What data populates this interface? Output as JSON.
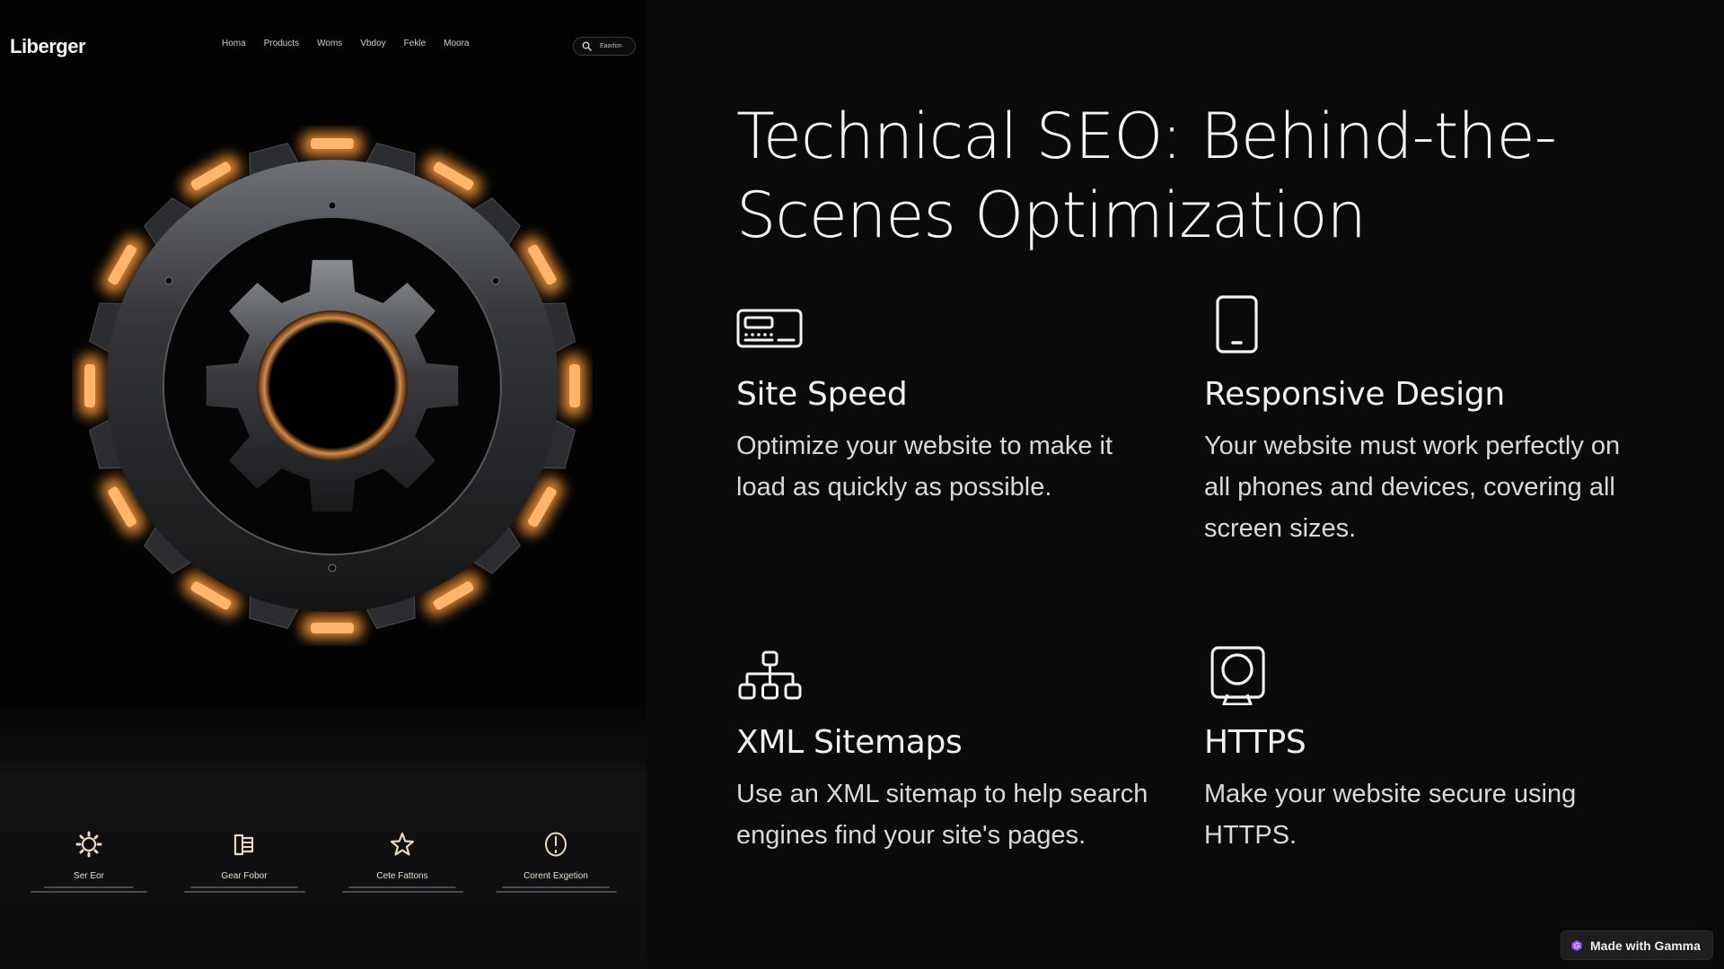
{
  "left_panel": {
    "logo": "Liberger",
    "nav": [
      "Homa",
      "Products",
      "Woms",
      "Vbdoy",
      "Fekle",
      "Moora"
    ],
    "search_label": "Eaarfon",
    "hero_image": "glowing-gear",
    "features": [
      {
        "icon": "gear-icon",
        "title": "Ser Eor"
      },
      {
        "icon": "folder-icon",
        "title": "Gear Fobor"
      },
      {
        "icon": "star-icon",
        "title": "Cete Fattons"
      },
      {
        "icon": "alert-circle-icon",
        "title": "Corent Exgetion"
      }
    ],
    "accent_color": "#ffb66b"
  },
  "main": {
    "title": "Technical SEO: Behind-the-Scenes Optimization",
    "features": [
      {
        "icon": "credit-card-icon",
        "heading": "Site Speed",
        "body": "Optimize your website to make it load as quickly as possible."
      },
      {
        "icon": "smartphone-icon",
        "heading": "Responsive Design",
        "body": "Your website must work perfectly on all phones and devices, covering all screen sizes."
      },
      {
        "icon": "sitemap-icon",
        "heading": "XML Sitemaps",
        "body": "Use an XML sitemap to help search engines find your site's pages."
      },
      {
        "icon": "webcam-icon",
        "heading": "HTTPS",
        "body": "Make your website secure using HTTPS."
      }
    ]
  },
  "badge": {
    "label": "Made with Gamma",
    "icon": "gamma-logo-icon",
    "color": "#8b5cf6"
  }
}
